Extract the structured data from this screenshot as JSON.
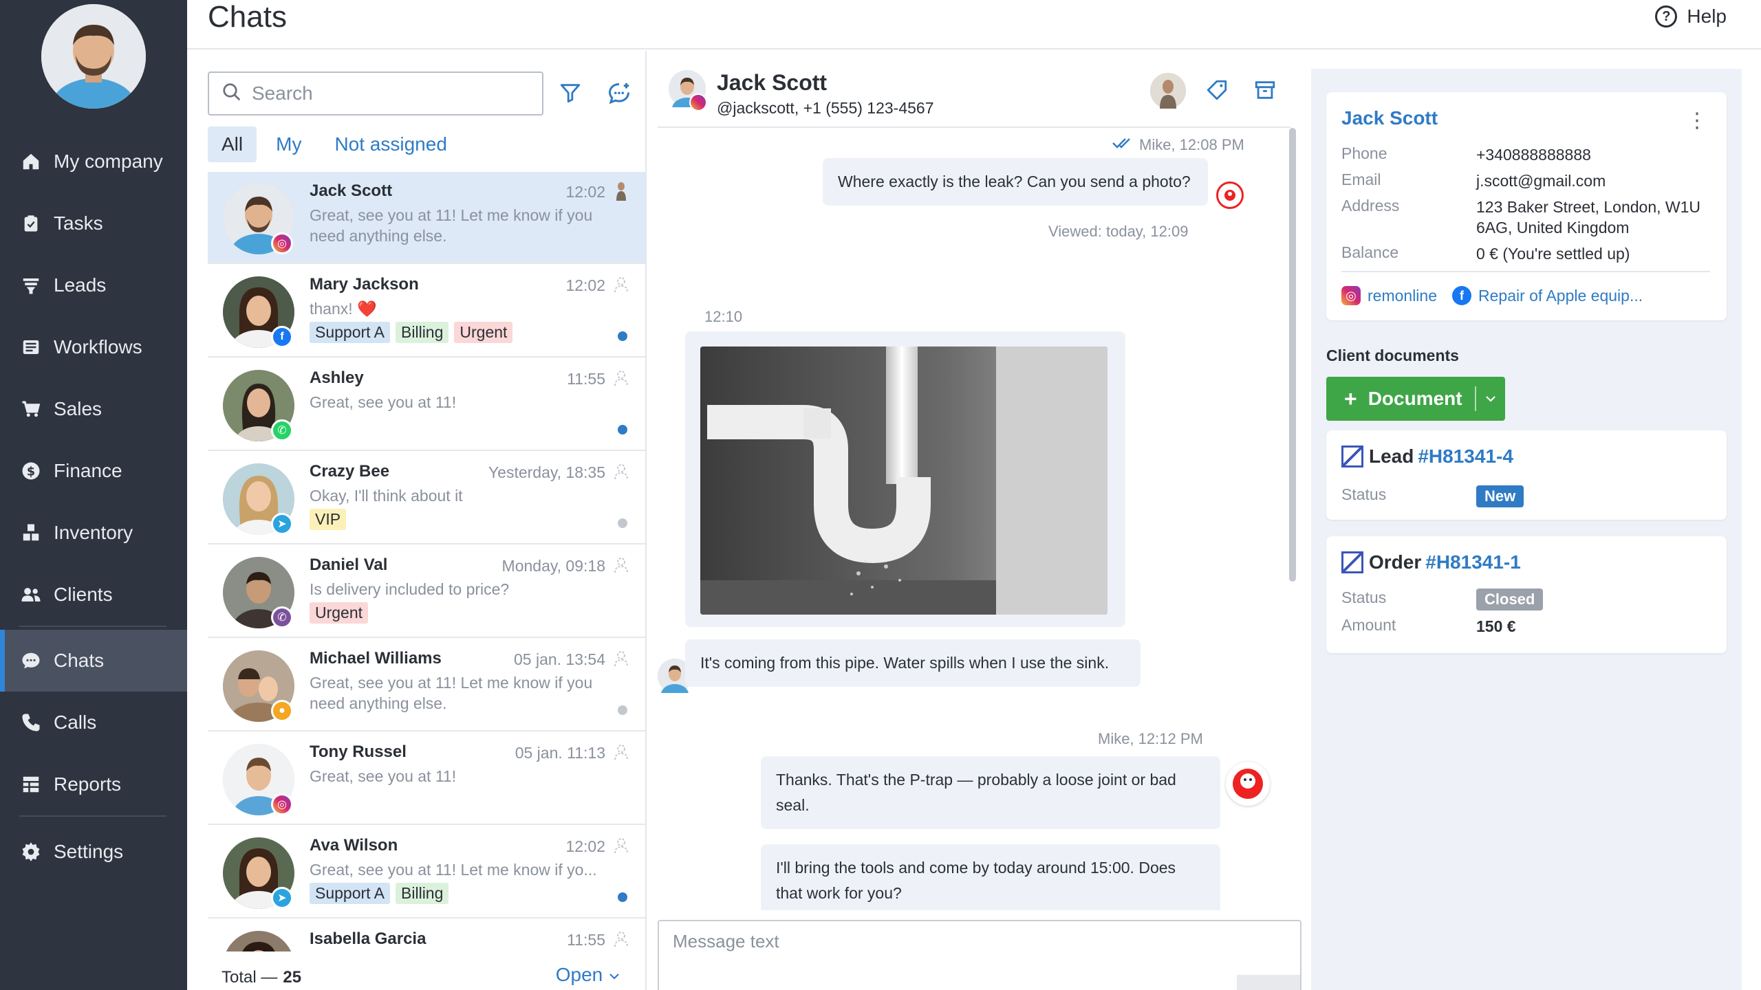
{
  "page": {
    "title": "Chats",
    "help_label": "Help"
  },
  "sidebar": {
    "items": [
      {
        "label": "My company",
        "icon": "home-icon"
      },
      {
        "label": "Tasks",
        "icon": "clipboard-icon"
      },
      {
        "label": "Leads",
        "icon": "funnel-icon"
      },
      {
        "label": "Workflows",
        "icon": "newspaper-icon"
      },
      {
        "label": "Sales",
        "icon": "cart-icon"
      },
      {
        "label": "Finance",
        "icon": "dollar-coin-icon"
      },
      {
        "label": "Inventory",
        "icon": "boxes-icon"
      },
      {
        "label": "Clients",
        "icon": "users-icon"
      },
      {
        "label": "Chats",
        "icon": "chat-bubble-icon",
        "active": true
      },
      {
        "label": "Calls",
        "icon": "phone-icon"
      },
      {
        "label": "Reports",
        "icon": "table-icon"
      },
      {
        "label": "Settings",
        "icon": "gear-icon"
      }
    ]
  },
  "chatlist": {
    "search_placeholder": "Search",
    "tabs": [
      "All",
      "My",
      "Not assigned"
    ],
    "items": [
      {
        "name": "Jack Scott",
        "time": "12:02",
        "message": "Great, see you at 11! Let me know if you need anything else.",
        "channel": "instagram",
        "tags": [],
        "dot": null,
        "selected": true
      },
      {
        "name": "Mary Jackson",
        "time": "12:02",
        "message": "thanx! ❤️",
        "channel": "facebook",
        "tags": [
          [
            "Support A",
            "blue"
          ],
          [
            "Billing",
            "green"
          ],
          [
            "Urgent",
            "red"
          ]
        ],
        "dot": "blue"
      },
      {
        "name": "Ashley",
        "time": "11:55",
        "message": "Great, see you at 11!",
        "channel": "whatsapp",
        "tags": [],
        "dot": "blue"
      },
      {
        "name": "Crazy Bee",
        "time": "Yesterday, 18:35",
        "message": "Okay, I'll think about it",
        "channel": "telegram",
        "tags": [
          [
            "VIP",
            "yellow"
          ]
        ],
        "dot": "grey"
      },
      {
        "name": "Daniel Val",
        "time": "Monday, 09:18",
        "message": "Is delivery included to price?",
        "channel": "viber",
        "tags": [
          [
            "Urgent",
            "red"
          ]
        ],
        "dot": null
      },
      {
        "name": "Michael Williams",
        "time": "05 jan. 13:54",
        "message": "Great, see you at 11! Let me know if you need anything else.",
        "channel": "other",
        "tags": [],
        "dot": "grey"
      },
      {
        "name": "Tony Russel",
        "time": "05 jan. 11:13",
        "message": "Great, see you at 11!",
        "channel": "instagram",
        "tags": [],
        "dot": null
      },
      {
        "name": "Ava Wilson",
        "time": "12:02",
        "message": "Great, see you at 11! Let me know if yo...",
        "channel": "telegram",
        "tags": [
          [
            "Support A",
            "blue"
          ],
          [
            "Billing",
            "green"
          ]
        ],
        "dot": "blue"
      },
      {
        "name": "Isabella Garcia",
        "time": "11:55",
        "message": "",
        "channel": "",
        "tags": [],
        "dot": null
      }
    ],
    "total_label": "Total —",
    "total_value": "25",
    "status_select": "Open"
  },
  "chat": {
    "name": "Jack Scott",
    "subtitle": "@jackscott, +1 (555) 123-4567",
    "messages": {
      "m1_meta": "Mike, 12:08 PM",
      "m1_text": "Where exactly is the leak? Can you send a photo?",
      "m1_viewed": "Viewed: today, 12:09",
      "photo_time": "12:10",
      "m2_text": "It's coming from this pipe. Water spills when I use the sink.",
      "m3_meta": "Mike, 12:12 PM",
      "m3_text": "Thanks. That's the P-trap — probably a loose joint or bad seal.",
      "m4_text": "I'll bring the tools and come by today around 15:00. Does that work for you?"
    },
    "composer_placeholder": "Message text"
  },
  "client": {
    "name": "Jack Scott",
    "phone_label": "Phone",
    "phone": "+340888888888",
    "email_label": "Email",
    "email": "j.scott@gmail.com",
    "address_label": "Address",
    "address": "123 Baker Street, London, W1U 6AG, United Kingdom",
    "balance_label": "Balance",
    "balance": "0 € (You're settled up)",
    "link_instagram": "remonline",
    "link_facebook": "Repair of Apple equip..."
  },
  "documents": {
    "title": "Client documents",
    "add_button": "Document",
    "lead": {
      "type": "Lead",
      "number": "#H81341-4",
      "status_label": "Status",
      "status": "New",
      "status_color": "#2f7bc4"
    },
    "order": {
      "type": "Order",
      "number": "#H81341-1",
      "status_label": "Status",
      "status": "Closed",
      "status_color": "#9aa1ab",
      "amount_label": "Amount",
      "amount": "150 €"
    }
  },
  "colors": {
    "sidebar": "#2e3440",
    "accent": "#2f7bc4",
    "green": "#3fa648",
    "selected_bg": "#dde9f6"
  }
}
